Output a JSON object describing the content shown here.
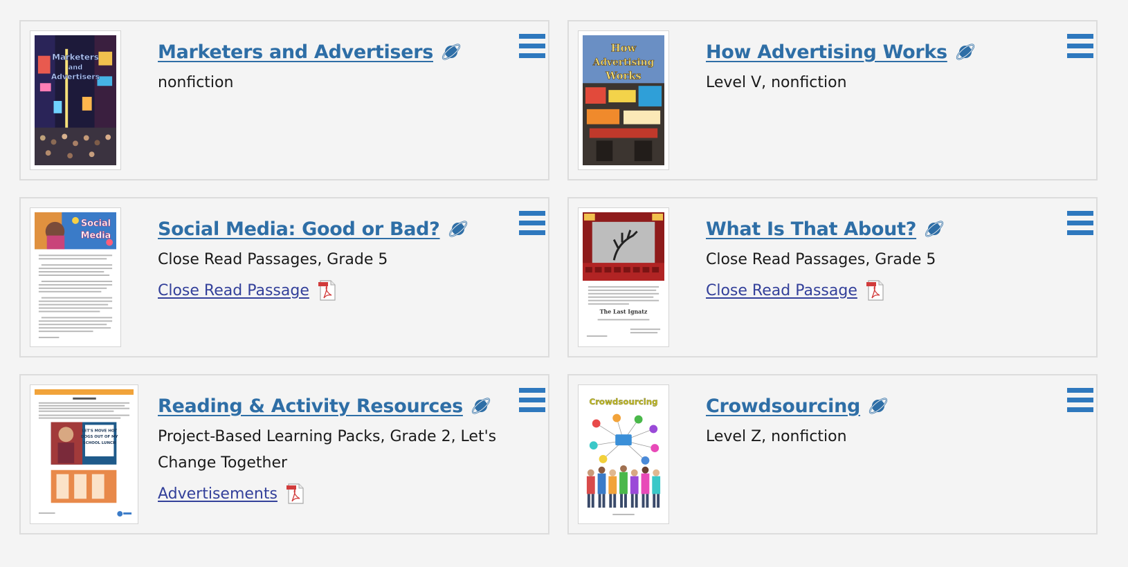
{
  "colors": {
    "title": "#2e6ea6",
    "link": "#33409a",
    "menu": "#2e78be",
    "pdf": "#d13b3b"
  },
  "cards": [
    {
      "title": "Marketers and Advertisers",
      "meta": "nonfiction",
      "thumb_text": "Marketers and Advertisers",
      "icons": [
        "planet-icon",
        "menu-icon"
      ]
    },
    {
      "title": "How Advertising Works",
      "meta": "Level V, nonfiction",
      "thumb_text": "How Advertising Works",
      "icons": [
        "planet-icon",
        "menu-icon"
      ]
    },
    {
      "title": "Social Media: Good or Bad?",
      "meta": "Close Read Passages, Grade 5",
      "resource": "Close Read Passage",
      "thumb_text": "Social Media",
      "icons": [
        "planet-icon",
        "menu-icon",
        "pdf-icon"
      ]
    },
    {
      "title": "What Is That About?",
      "meta": "Close Read Passages, Grade 5",
      "resource": "Close Read Passage",
      "thumb_text": "The Last Ignatz",
      "icons": [
        "planet-icon",
        "menu-icon",
        "pdf-icon"
      ]
    },
    {
      "title": "Reading & Activity Resources",
      "meta": "Project-Based Learning Packs, Grade 2, Let's Change Together",
      "resource": "Advertisements",
      "thumb_text": "LET'S MOVE HOT DOGS OUT OF MY SCHOOL LUNCH",
      "icons": [
        "planet-icon",
        "menu-icon",
        "pdf-icon"
      ]
    },
    {
      "title": "Crowdsourcing",
      "meta": "Level Z, nonfiction",
      "thumb_text": "Crowdsourcing",
      "icons": [
        "planet-icon",
        "menu-icon"
      ]
    }
  ]
}
